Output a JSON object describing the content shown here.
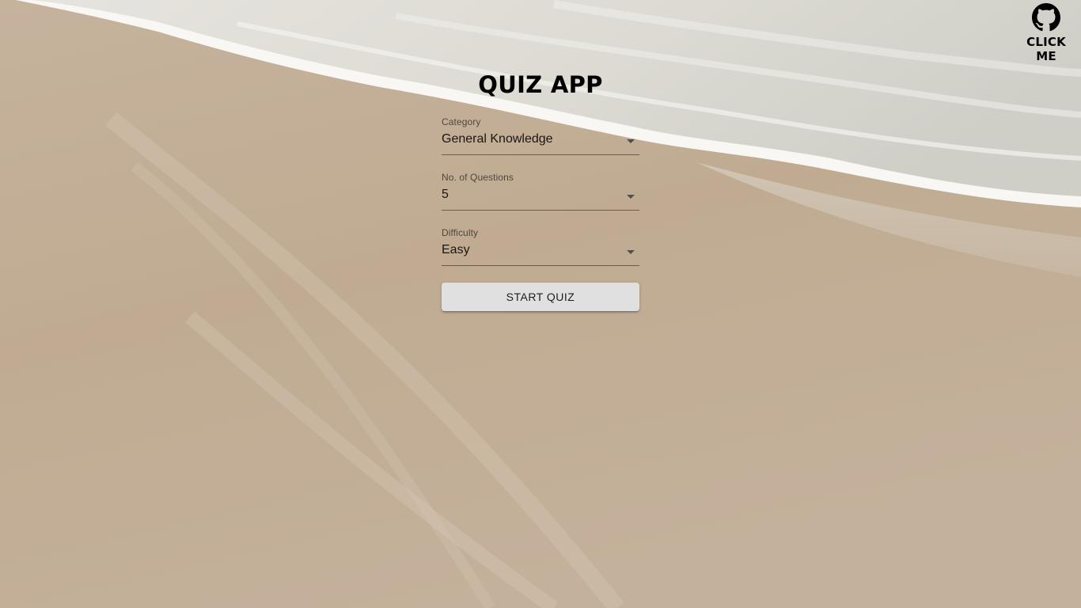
{
  "header": {
    "github_label": "CLICK ME",
    "github_icon": "github-icon"
  },
  "app": {
    "title": "QUIZ APP",
    "fields": [
      {
        "label": "Category",
        "value": "General Knowledge"
      },
      {
        "label": "No. of Questions",
        "value": "5"
      },
      {
        "label": "Difficulty",
        "value": "Easy"
      }
    ],
    "start_label": "START QUIZ"
  },
  "colors": {
    "sand": "#c4b098",
    "water": "#d8d6cf",
    "foam": "#f7f6f3",
    "button": "#e0e0e0",
    "text": "#000000"
  }
}
